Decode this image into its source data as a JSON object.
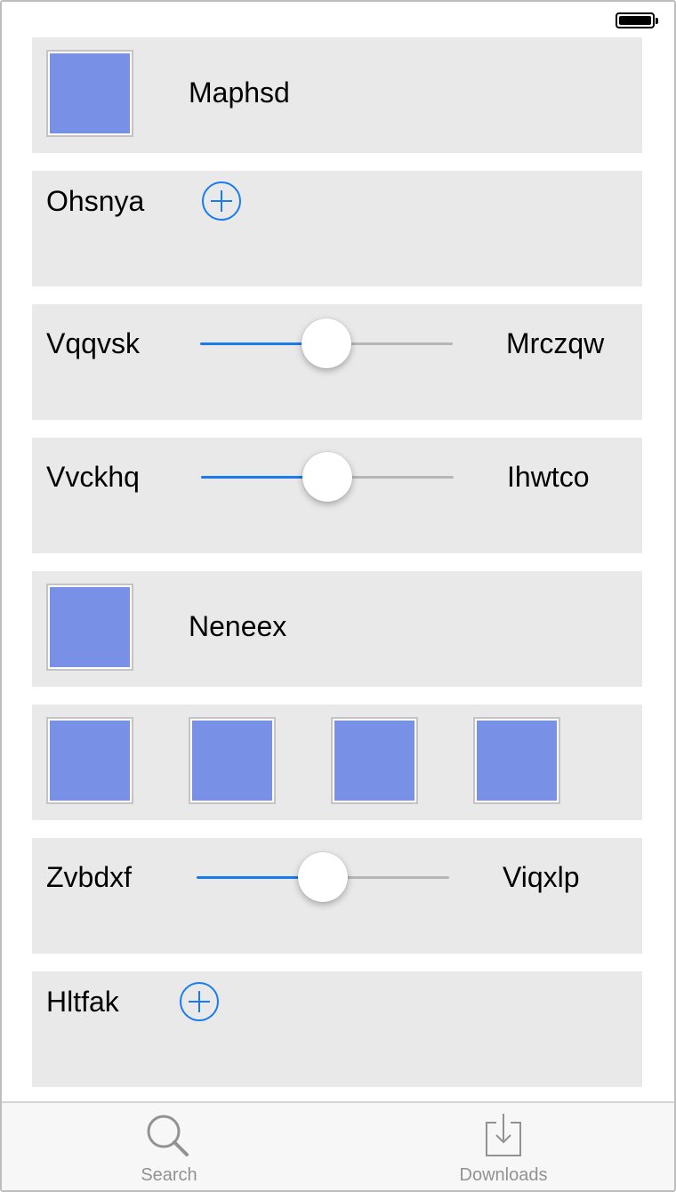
{
  "rows": {
    "row1": {
      "label": "Maphsd"
    },
    "row2": {
      "label": "Ohsnya"
    },
    "row3": {
      "left": "Vqqvsk",
      "right": "Mrczqw",
      "value": 0.5
    },
    "row4": {
      "left": "Vvckhq",
      "right": "Ihwtco",
      "value": 0.5
    },
    "row5": {
      "label": "Neneex"
    },
    "row7": {
      "left": "Zvbdxf",
      "right": "Viqxlp",
      "value": 0.5
    },
    "row8": {
      "label": "Hltfak"
    }
  },
  "tabbar": {
    "search": {
      "label": "Search",
      "icon": "search-icon"
    },
    "downloads": {
      "label": "Downloads",
      "icon": "download-tray-icon"
    }
  },
  "colors": {
    "accent": "#1a7bf0",
    "thumbnail": "#7890e6",
    "card_background": "#e9e9e9",
    "tabbar_label": "#929292"
  }
}
